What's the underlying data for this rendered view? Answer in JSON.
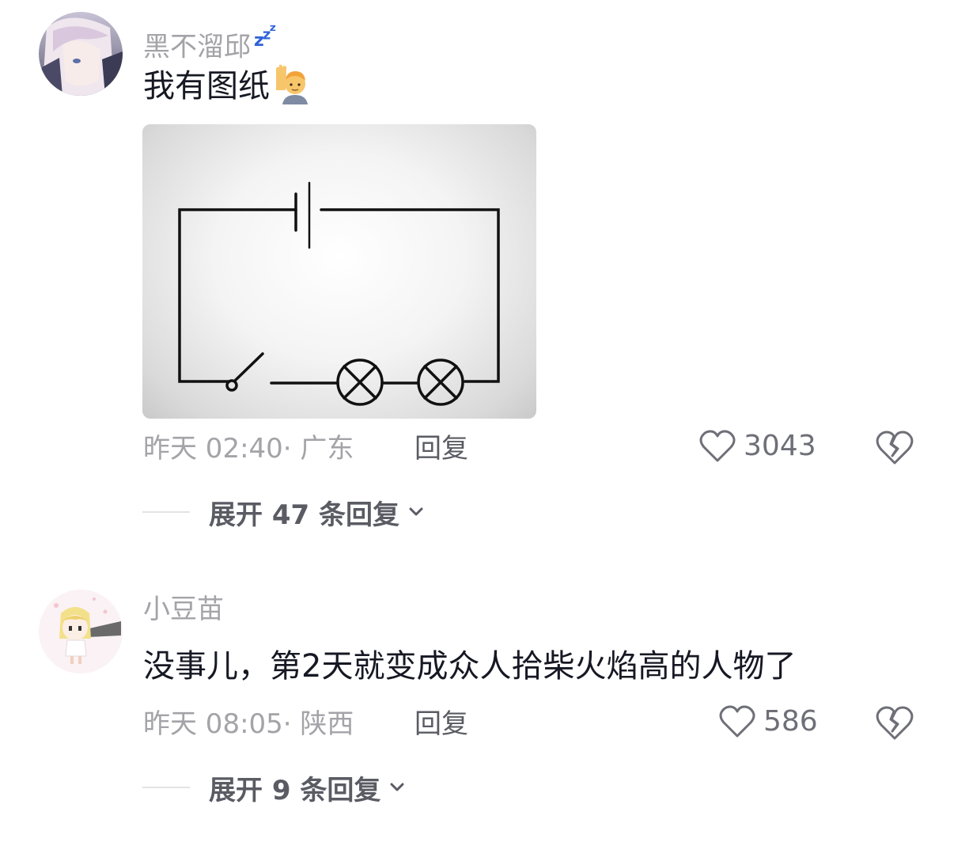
{
  "comments": [
    {
      "username": "黑不溜邱",
      "username_badge": "zzz",
      "text": "我有图纸",
      "emoji": "raising-hand-emoji",
      "has_image": true,
      "time": "昨天 02:40",
      "location": "广东",
      "reply_label": "回复",
      "likes": "3043",
      "expand_label": "展开 47 条回复"
    },
    {
      "username": "小豆苗",
      "text": "没事儿，第2天就变成众人拾柴火焰高的人物了",
      "time": "昨天 08:05",
      "location": "陕西",
      "reply_label": "回复",
      "likes": "586",
      "expand_label": "展开 9 条回复"
    }
  ],
  "icons": {
    "like": "heart-outline-icon",
    "dislike": "broken-heart-icon",
    "expand": "chevron-down-icon"
  },
  "colors": {
    "meta_text": "#a3a3a8",
    "primary_text": "#161823",
    "action_text": "#5a5b63",
    "badge_blue": "#2f62d8"
  }
}
